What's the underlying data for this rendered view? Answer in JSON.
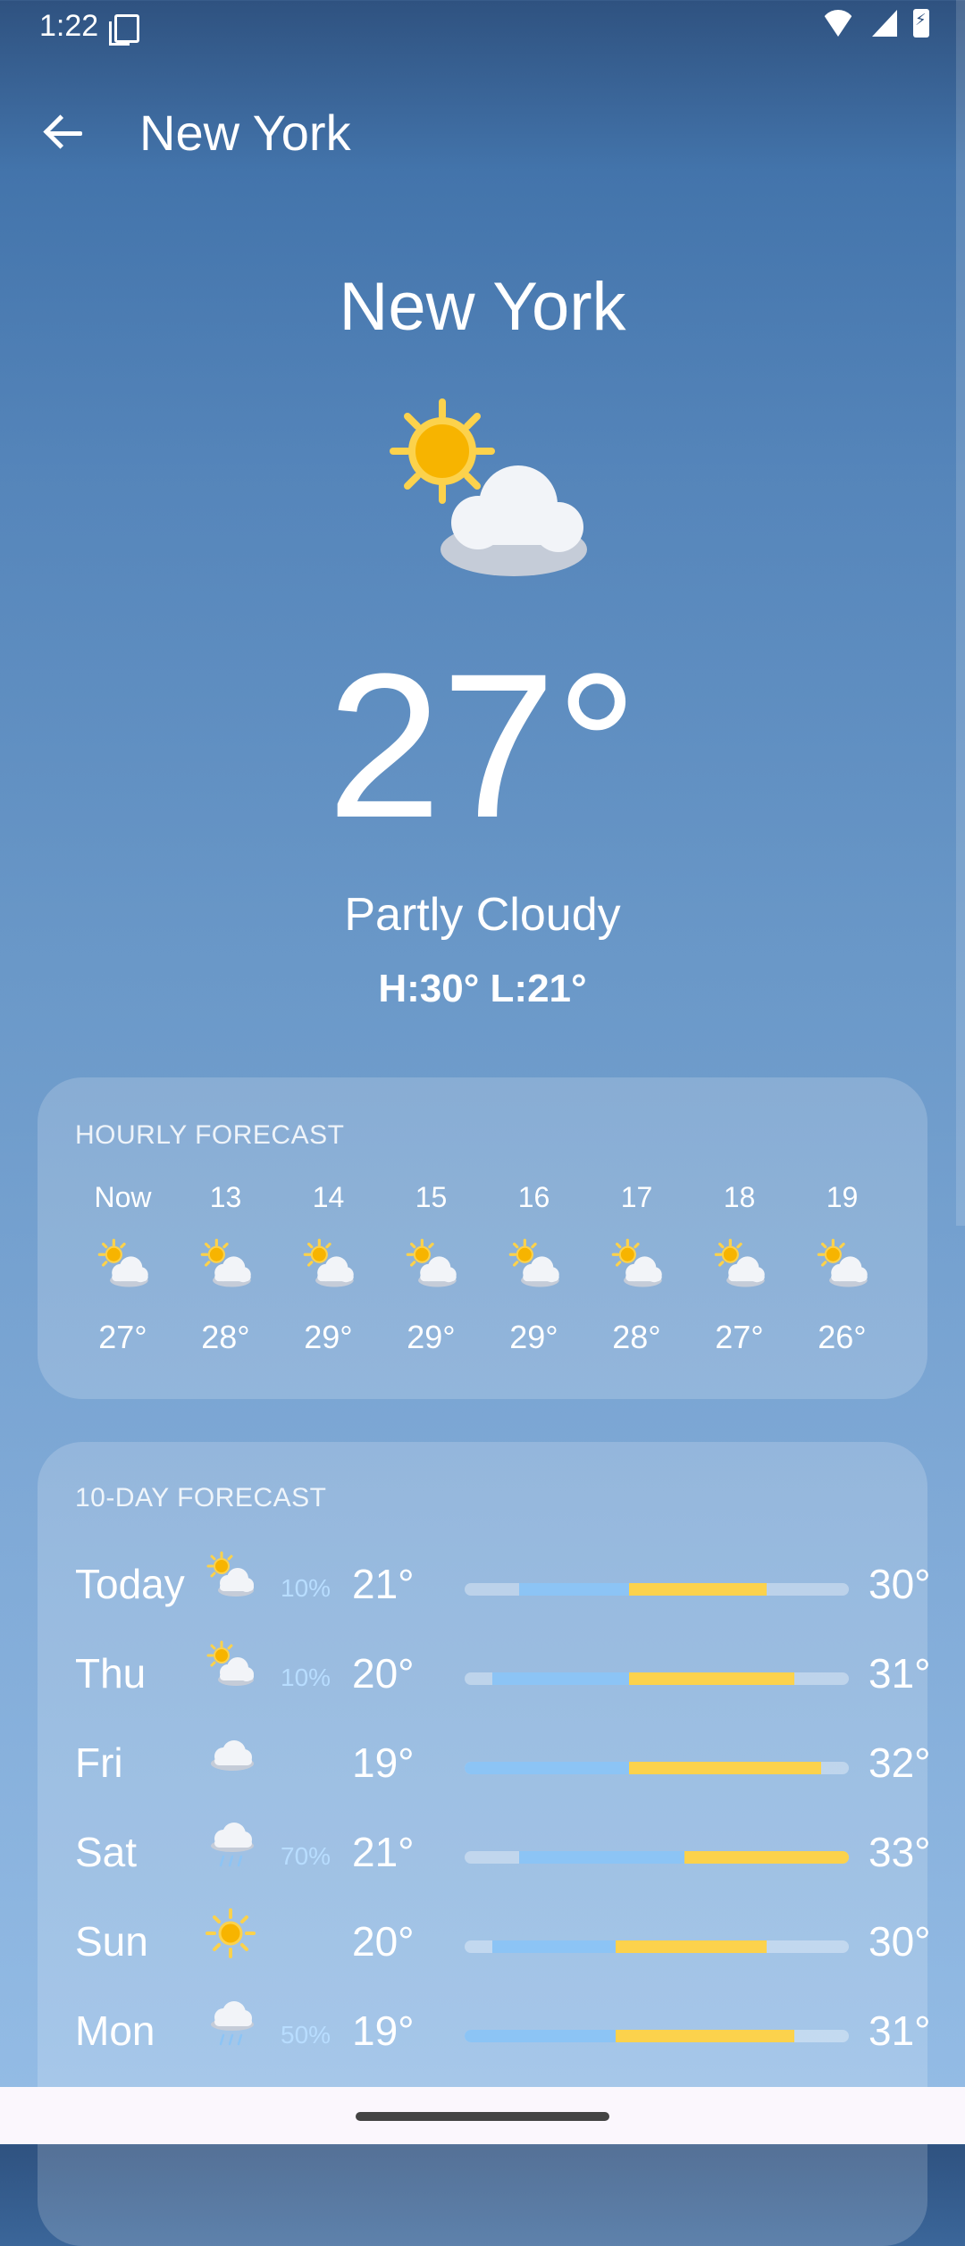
{
  "status": {
    "time": "1:22"
  },
  "appbar": {
    "title": "New York"
  },
  "current": {
    "city": "New York",
    "temp": "27°",
    "condition": "Partly Cloudy",
    "hilo": "H:30° L:21°",
    "icon": "partly-cloudy-icon"
  },
  "hourly": {
    "heading": "HOURLY FORECAST",
    "items": [
      {
        "time": "Now",
        "temp": "27°",
        "icon": "partly-cloudy-icon"
      },
      {
        "time": "13",
        "temp": "28°",
        "icon": "partly-cloudy-icon"
      },
      {
        "time": "14",
        "temp": "29°",
        "icon": "partly-cloudy-icon"
      },
      {
        "time": "15",
        "temp": "29°",
        "icon": "partly-cloudy-icon"
      },
      {
        "time": "16",
        "temp": "29°",
        "icon": "partly-cloudy-icon"
      },
      {
        "time": "17",
        "temp": "28°",
        "icon": "partly-cloudy-icon"
      },
      {
        "time": "18",
        "temp": "27°",
        "icon": "partly-cloudy-icon"
      },
      {
        "time": "19",
        "temp": "26°",
        "icon": "partly-cloudy-icon"
      }
    ]
  },
  "daily": {
    "heading": "10-DAY FORECAST",
    "range": [
      19,
      33
    ],
    "days": [
      {
        "name": "Today",
        "icon": "partly-cloudy-icon",
        "precip": "10%",
        "low": "21°",
        "high": "30°",
        "lowVal": 21,
        "highVal": 30,
        "split": 25
      },
      {
        "name": "Thu",
        "icon": "partly-cloudy-icon",
        "precip": "10%",
        "low": "20°",
        "high": "31°",
        "lowVal": 20,
        "highVal": 31,
        "split": 25
      },
      {
        "name": "Fri",
        "icon": "cloud-icon",
        "precip": "",
        "low": "19°",
        "high": "32°",
        "lowVal": 19,
        "highVal": 32,
        "split": 25
      },
      {
        "name": "Sat",
        "icon": "rain-icon",
        "precip": "70%",
        "low": "21°",
        "high": "33°",
        "lowVal": 21,
        "highVal": 33,
        "split": 27
      },
      {
        "name": "Sun",
        "icon": "sun-icon",
        "precip": "",
        "low": "20°",
        "high": "30°",
        "lowVal": 20,
        "highVal": 30,
        "split": 24.5
      },
      {
        "name": "Mon",
        "icon": "rain-icon",
        "precip": "50%",
        "low": "19°",
        "high": "31°",
        "lowVal": 19,
        "highVal": 31,
        "split": 24.5
      }
    ]
  },
  "colors": {
    "cool": "#8cc4f5",
    "warm": "#fcd24c",
    "sun": "#f7b400"
  }
}
